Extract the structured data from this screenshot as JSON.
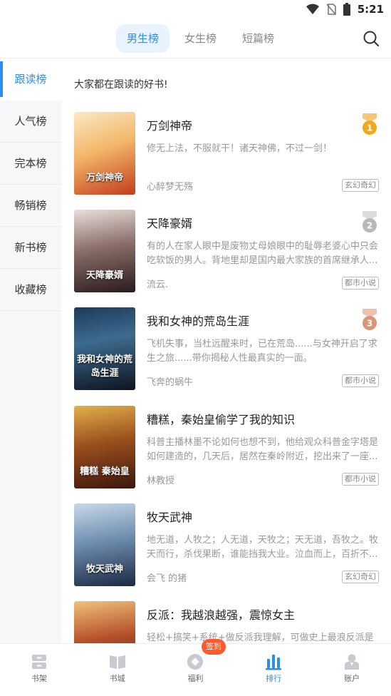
{
  "status_bar": {
    "time": "5:21"
  },
  "header": {
    "tabs": [
      {
        "label": "男生榜",
        "active": true
      },
      {
        "label": "女生榜",
        "active": false
      },
      {
        "label": "短篇榜",
        "active": false
      }
    ]
  },
  "sidebar": {
    "items": [
      {
        "label": "跟读榜",
        "active": true
      },
      {
        "label": "人气榜",
        "active": false
      },
      {
        "label": "完本榜",
        "active": false
      },
      {
        "label": "畅销榜",
        "active": false
      },
      {
        "label": "新书榜",
        "active": false
      },
      {
        "label": "收藏榜",
        "active": false
      }
    ]
  },
  "main": {
    "subtitle": "大家都在跟读的好书!",
    "books": [
      {
        "title": "万剑神帝",
        "desc": "修无上法，不服就干！诸天神佛，不过一剑！",
        "author": "心醉梦无殇",
        "tag": "玄幻奇幻",
        "rank": "1",
        "cover_text": "万剑神帝"
      },
      {
        "title": "天降豪婿",
        "desc": "有的人在家人眼中是废物丈母娘眼中的耻辱老婆心中只会吃软饭的男人。背地里却是国内最大家族的首席继承人...",
        "author": "流云.",
        "tag": "都市小说",
        "rank": "2",
        "cover_text": "天降豪婿"
      },
      {
        "title": "我和女神的荒岛生涯",
        "desc": "飞机失事，当杜远醒来时，已在荒岛......与女神开启了求生之旅......带你揭秘人性最真实的一面。",
        "author": "飞奔的蜗牛",
        "tag": "都市小说",
        "rank": "3",
        "cover_text": "我和女神的荒岛生涯"
      },
      {
        "title": "糟糕，秦始皇偷学了我的知识",
        "desc": "科普主播林墨不论如何也想不到，他给观众科普金字塔是如何建造的，几天后，居然在秦岭附近，挖出来了一座...",
        "author": "林教授",
        "tag": "都市小说",
        "rank": "",
        "cover_text": "糟糕 秦始皇"
      },
      {
        "title": "牧天武神",
        "desc": "地无道，人牧之；人无道，天牧之；天无道，吾牧之。牧天而行，杀伐果断，谁能挡我大业。泣血而上，百折不...",
        "author": "会飞 的猪",
        "tag": "玄幻奇幻",
        "rank": "",
        "cover_text": "牧天武神"
      },
      {
        "title": "反派：我越浪越强，震惊女主",
        "desc": "轻松+搞笑+系统+做反派我理解，可做史上最浪反派是什么鬼？",
        "author": "",
        "tag": "",
        "rank": "",
        "cover_text": ""
      }
    ]
  },
  "bottom_nav": {
    "items": [
      {
        "label": "书架",
        "active": false
      },
      {
        "label": "书城",
        "active": false
      },
      {
        "label": "福利",
        "active": false
      },
      {
        "label": "排行",
        "active": true
      },
      {
        "label": "账户",
        "active": false
      }
    ],
    "badge": "签到"
  },
  "colors": {
    "accent": "#2d8cf0",
    "badge": "#ff5a2c",
    "gold": "#f2a81d",
    "silver": "#b8b8b8",
    "bronze": "#d8957a"
  }
}
